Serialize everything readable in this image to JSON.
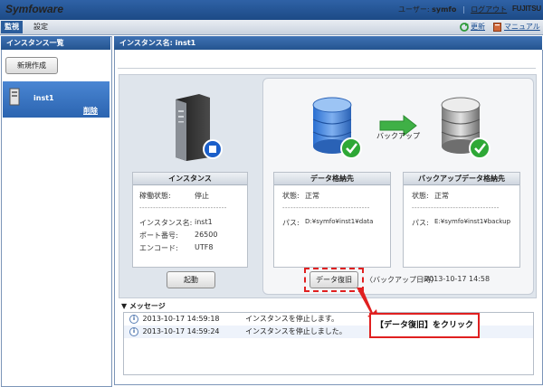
{
  "app": {
    "logo": "Symfoware",
    "brand": "FUJITSU"
  },
  "user_bar": {
    "user_label": "ユーザー:",
    "user_name": "symfo",
    "separator": "|",
    "logout": "ログアウト"
  },
  "tabs": [
    {
      "label": "監視",
      "active": true
    },
    {
      "label": "設定",
      "active": false
    }
  ],
  "top_links": {
    "refresh": "更新",
    "manual": "マニュアル"
  },
  "sidebar": {
    "title": "インスタンス一覧",
    "new_button": "新規作成",
    "items": [
      {
        "name": "inst1",
        "delete": "削除"
      }
    ]
  },
  "main": {
    "title": "インスタンス名: inst1",
    "instance_card": {
      "title": "インスタンス",
      "status_label": "稼働状態:",
      "status_value": "停止",
      "dashes": "--------------------------------",
      "name_label": "インスタンス名:",
      "name_value": "inst1",
      "port_label": "ポート番号:",
      "port_value": "26500",
      "encoding_label": "エンコード:",
      "encoding_value": "UTF8"
    },
    "start_button": "起動",
    "data_card": {
      "title": "データ格納先",
      "status_label": "状態:",
      "status_value": "正常",
      "dashes": "--------------------------------",
      "path_label": "パス:",
      "path_value": "D:¥symfo¥inst1¥data"
    },
    "backup_card": {
      "title": "バックアップデータ格納先",
      "status_label": "状態:",
      "status_value": "正常",
      "dashes": "--------------------------------",
      "path_label": "パス:",
      "path_value": "E:¥symfo¥inst1¥backup"
    },
    "backup_button": "バックアップ",
    "restore_button": "データ復旧",
    "backup_datetime_label": "〈バックアップ日時〉",
    "backup_datetime": "2013-10-17 14:58"
  },
  "messages": {
    "title": "メッセージ",
    "rows": [
      {
        "time": "2013-10-17 14:59:18",
        "text": "インスタンスを停止します。"
      },
      {
        "time": "2013-10-17 14:59:24",
        "text": "インスタンスを停止しました。"
      }
    ]
  },
  "callout": {
    "text": "【データ復旧】をクリック"
  },
  "colors": {
    "header_blue": "#24548f",
    "selected_item": "#2b64b0",
    "callout_red": "#e02020",
    "ok_green": "#2ea836"
  }
}
